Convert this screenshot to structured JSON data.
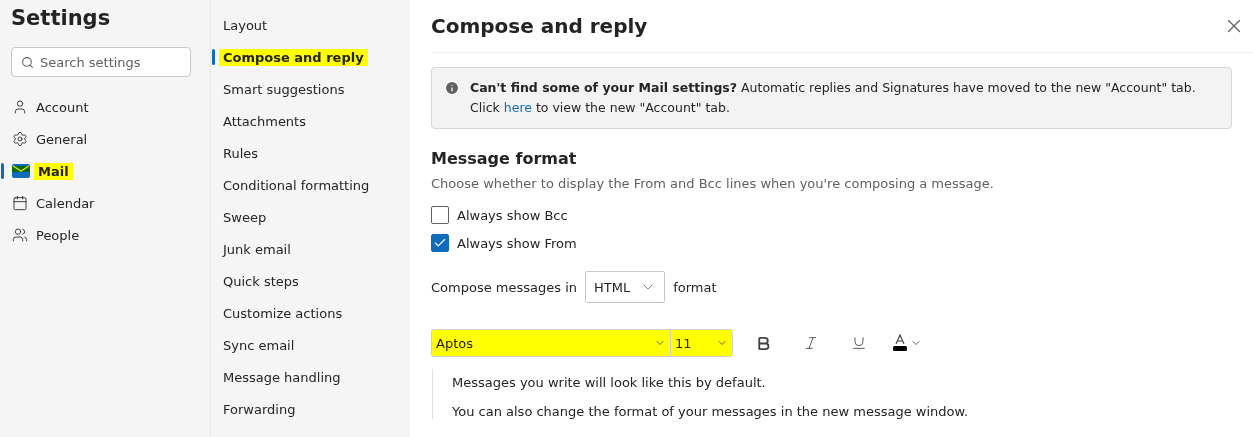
{
  "sidebar": {
    "title": "Settings",
    "search": {
      "placeholder": "Search settings"
    },
    "items": [
      {
        "label": "Account",
        "selected": false,
        "highlighted": false
      },
      {
        "label": "General",
        "selected": false,
        "highlighted": false
      },
      {
        "label": "Mail",
        "selected": true,
        "highlighted": true
      },
      {
        "label": "Calendar",
        "selected": false,
        "highlighted": false
      },
      {
        "label": "People",
        "selected": false,
        "highlighted": false
      }
    ]
  },
  "submenu": {
    "items": [
      {
        "label": "Layout",
        "selected": false,
        "highlighted": false
      },
      {
        "label": "Compose and reply",
        "selected": true,
        "highlighted": true
      },
      {
        "label": "Smart suggestions",
        "selected": false,
        "highlighted": false
      },
      {
        "label": "Attachments",
        "selected": false,
        "highlighted": false
      },
      {
        "label": "Rules",
        "selected": false,
        "highlighted": false
      },
      {
        "label": "Conditional formatting",
        "selected": false,
        "highlighted": false
      },
      {
        "label": "Sweep",
        "selected": false,
        "highlighted": false
      },
      {
        "label": "Junk email",
        "selected": false,
        "highlighted": false
      },
      {
        "label": "Quick steps",
        "selected": false,
        "highlighted": false
      },
      {
        "label": "Customize actions",
        "selected": false,
        "highlighted": false
      },
      {
        "label": "Sync email",
        "selected": false,
        "highlighted": false
      },
      {
        "label": "Message handling",
        "selected": false,
        "highlighted": false
      },
      {
        "label": "Forwarding",
        "selected": false,
        "highlighted": false
      }
    ]
  },
  "panel": {
    "title": "Compose and reply",
    "notice": {
      "text": "**Can't find some of your Mail settings?** Automatic replies and Signatures have moved to the new \"Account\" tab. Click",
      "link": "here",
      "text_after": "to view the new \"Account\" tab."
    },
    "section": {
      "title": "Message format",
      "description": "Choose whether to display the From and Bcc lines when you're composing a message.",
      "checkboxes": [
        {
          "label": "Always show Bcc",
          "checked": false
        },
        {
          "label": "Always show From",
          "checked": true
        }
      ],
      "compose_label": "Compose messages in",
      "compose_format": "HTML",
      "compose_suffix": "format",
      "toolbar": {
        "font": "Aptos",
        "size": "11",
        "highlighted": true
      },
      "preview": [
        "Messages you write will look like this by default.",
        "You can also change the format of your messages in the new message window."
      ]
    }
  }
}
